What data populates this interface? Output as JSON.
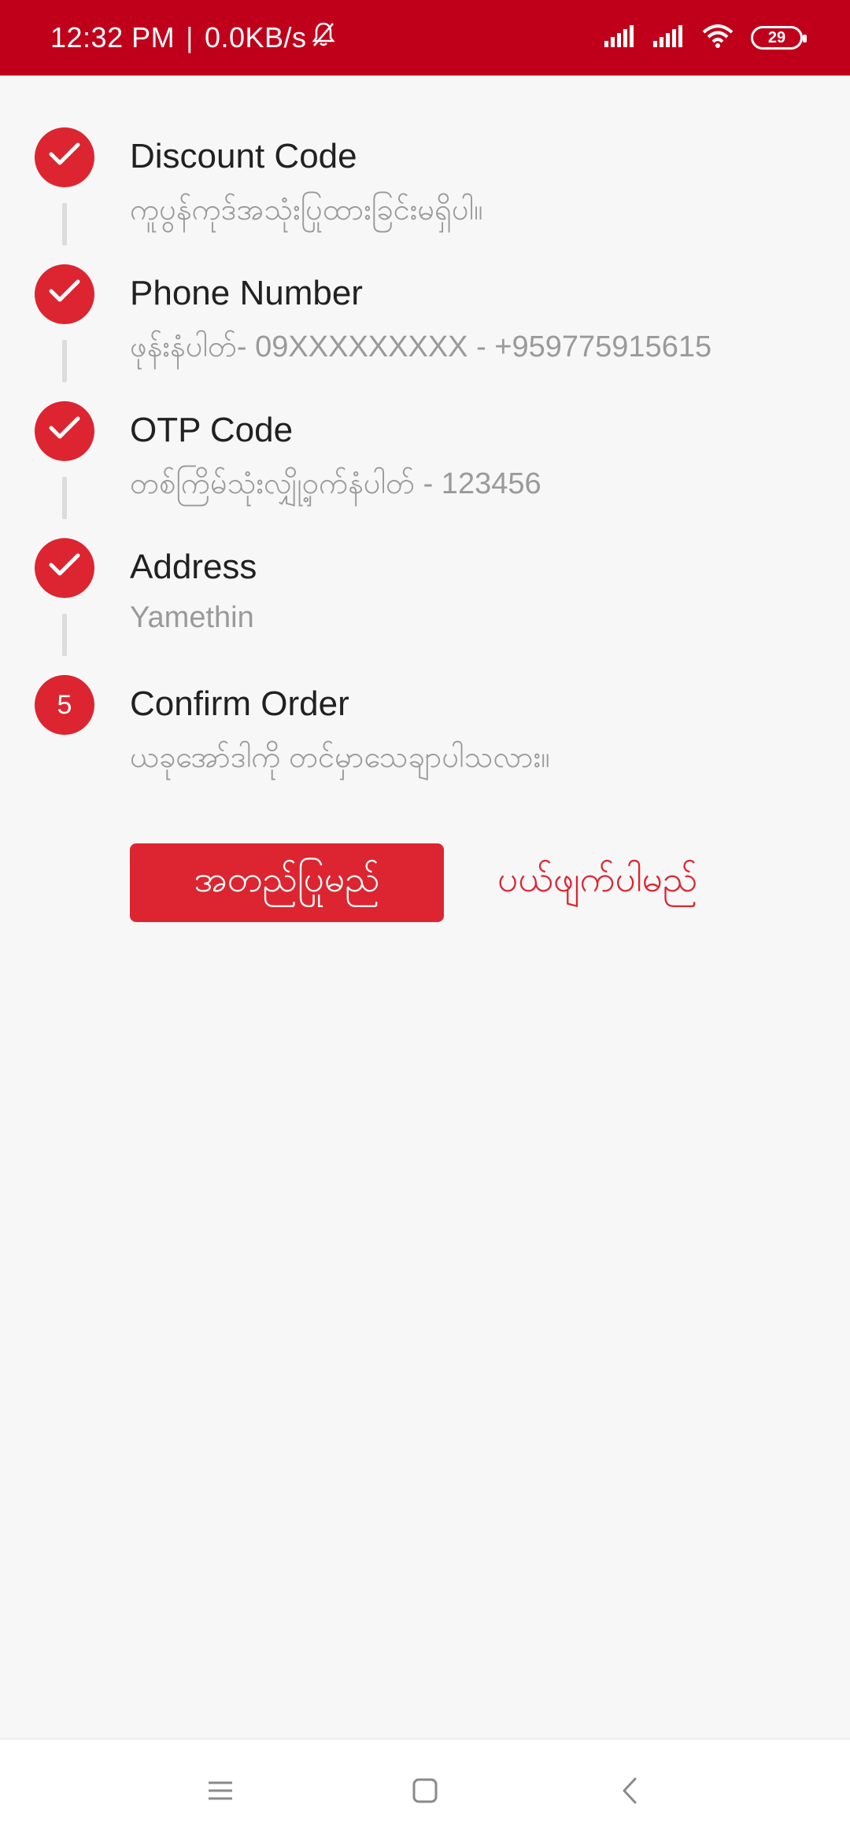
{
  "status_bar": {
    "time": "12:32 PM",
    "speed": "0.0KB/s",
    "battery_level": "29",
    "icons": [
      "mute-bell-icon",
      "signal-icon",
      "signal-icon",
      "wifi-icon",
      "battery-icon"
    ]
  },
  "steps": [
    {
      "title": "Discount Code",
      "subtitle": "ကူပွန်ကုဒ်အသုံးပြုထားခြင်းမရှိပါ။",
      "state": "done",
      "icon": "check-icon"
    },
    {
      "title": "Phone Number",
      "subtitle": "ဖုန်းနံပါတ်- 09XXXXXXXXX - +959775915615",
      "state": "done",
      "icon": "check-icon"
    },
    {
      "title": "OTP Code",
      "subtitle": "တစ်ကြိမ်သုံးလျှို့ဝှက်နံပါတ် - 123456",
      "state": "done",
      "icon": "check-icon"
    },
    {
      "title": "Address",
      "subtitle": "Yamethin",
      "state": "done",
      "icon": "check-icon"
    },
    {
      "title": "Confirm Order",
      "subtitle": "ယခုအော်ဒါကို တင်မှာသေချာပါသလား။",
      "state": "active",
      "number": "5"
    }
  ],
  "actions": {
    "confirm_label": "အတည်ပြုမည်",
    "cancel_label": "ပယ်ဖျက်ပါမည်"
  },
  "nav": {
    "icons": [
      "menu-icon",
      "home-square-icon",
      "back-chevron-icon"
    ]
  },
  "colors": {
    "accent": "#dc2530",
    "status_bar": "#c0001a",
    "background": "#f7f7f7"
  }
}
